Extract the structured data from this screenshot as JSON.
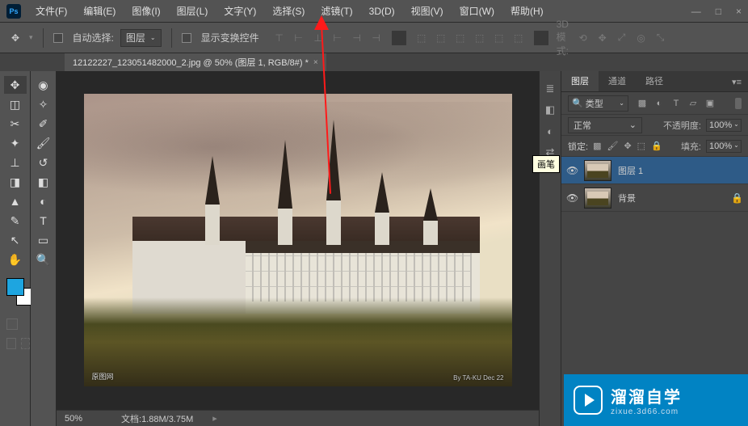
{
  "menu": {
    "file": "文件(F)",
    "edit": "编辑(E)",
    "image": "图像(I)",
    "layer": "图层(L)",
    "type": "文字(Y)",
    "select": "选择(S)",
    "filter": "滤镜(T)",
    "threed": "3D(D)",
    "view": "视图(V)",
    "window": "窗口(W)",
    "help": "帮助(H)"
  },
  "win": {
    "min": "—",
    "max": "□",
    "close": "×"
  },
  "options": {
    "autoselect": "自动选择:",
    "layerdd": "图层",
    "showcontrols": "显示变换控件",
    "mode3d": "3D 模式:"
  },
  "tab": {
    "name": "12122227_123051482000_2.jpg @ 50% (图层 1, RGB/8#) *",
    "close": "×"
  },
  "tooltip": "画笔",
  "panel": {
    "tabs": {
      "layers": "图层",
      "channels": "通道",
      "paths": "路径"
    },
    "filter": {
      "kind": "类型"
    },
    "blend": {
      "mode": "正常",
      "opacitylabel": "不透明度:",
      "opacity": "100%",
      "locklabel": "锁定:",
      "filllabel": "填充:",
      "fill": "100%"
    }
  },
  "layers": [
    {
      "name": "图层 1",
      "locked": false
    },
    {
      "name": "背景",
      "locked": true
    }
  ],
  "status": {
    "zoom": "50%",
    "doc": "文档:",
    " size": "1.88M/3.75M"
  },
  "brand": {
    "title": "溜溜自学",
    "url": "zixue.3d66.com"
  },
  "watermark": {
    "left": "原图网",
    "right": "By TA-KU  Dec 22"
  },
  "search_icon": "🔍"
}
